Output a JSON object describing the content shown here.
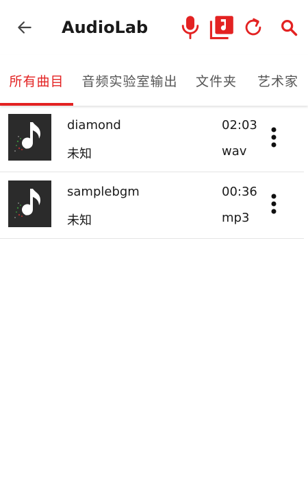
{
  "app": {
    "title": "AudioLab",
    "accent_color": "#e32222"
  },
  "appbar": {
    "back_icon": "arrow-left-icon",
    "actions": [
      {
        "icon": "microphone-icon",
        "color": "#e32222"
      },
      {
        "icon": "music-library-icon",
        "color": "#e32222"
      },
      {
        "icon": "refresh-icon",
        "color": "#e32222"
      },
      {
        "icon": "search-icon",
        "color": "#e32222"
      }
    ]
  },
  "tabs": [
    {
      "label": "所有曲目",
      "active": true
    },
    {
      "label": "音频实验室输出",
      "active": false
    },
    {
      "label": "文件夹",
      "active": false
    },
    {
      "label": "艺术家",
      "active": false
    }
  ],
  "tracks": [
    {
      "name": "diamond",
      "artist": "未知",
      "duration": "02:03",
      "format": "wav",
      "thumb_icon": "music-note-icon",
      "more_icon": "more-vertical-icon"
    },
    {
      "name": "samplebgm",
      "artist": "未知",
      "duration": "00:36",
      "format": "mp3",
      "thumb_icon": "music-note-icon",
      "more_icon": "more-vertical-icon"
    }
  ]
}
